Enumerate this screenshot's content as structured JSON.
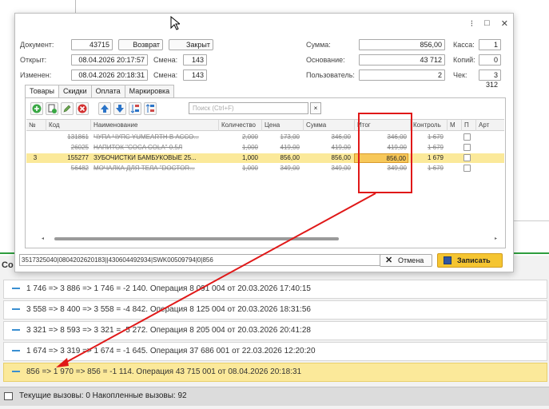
{
  "background": {
    "section_fragment": "Co"
  },
  "operations": [
    {
      "text": "1 746 => 3 886 => 1 746 = -2 140. Операция 8 091 004 от 20.03.2026 17:40:15"
    },
    {
      "text": "3 558 => 8 400 => 3 558 = -4 842. Операция 8 125 004 от 20.03.2026 18:31:56"
    },
    {
      "text": "3 321 => 8 593 => 3 321 = -5 272. Операция 8 205 004 от 20.03.2026 20:41:28"
    },
    {
      "text": "1 674 => 3 319 => 1 674 = -1 645. Операция 37 686 001 от 22.03.2026 12:20:20"
    },
    {
      "text": "856 => 1 970 => 856 = -1 114. Операция 43 715 001 от 08.04.2026 20:18:31",
      "selected": true
    }
  ],
  "status_bar": {
    "text": "Текущие вызовы: 0   Накопленные вызовы: 92"
  },
  "dialog": {
    "window_controls": [
      "⁝",
      "□",
      "✕"
    ],
    "document_label": "Документ:",
    "document_value": "43715",
    "return_button": "Возврат",
    "close_button": "Закрыт",
    "opened_label": "Открыт:",
    "opened_value": "08.04.2026 20:17:57",
    "shift_label": "Смена:",
    "shift_value": "143",
    "changed_label": "Изменен:",
    "changed_value": "08.04.2026 20:18:31",
    "shift2_label": "Смена:",
    "shift2_value": "143",
    "sum_label": "Сумма:",
    "sum_value": "856,00",
    "basis_label": "Основание:",
    "basis_value": "43 712",
    "user_label": "Пользователь:",
    "user_value": "2",
    "kassa_label": "Касса:",
    "kassa_value": "1",
    "copies_label": "Копий:",
    "copies_value": "0",
    "check_label": "Чек:",
    "check_value": "3 312",
    "tabs": [
      "Товары",
      "Скидки",
      "Оплата",
      "Маркировка"
    ],
    "search_placeholder": "Поиск (Ctrl+F)",
    "search_clear": "×",
    "columns": [
      "№",
      "Код",
      "Наименование",
      "Количество",
      "Цена",
      "Сумма",
      "Итог",
      "Контроль",
      "М",
      "П",
      "Арт"
    ],
    "rows": [
      {
        "num": "",
        "code": "131861",
        "name": "ЧУПА ЧУПС YUMEARTH В АССО...",
        "qty": "2,000",
        "price": "173,00",
        "sum": "346,00",
        "itog": "346,00",
        "control": "1 679",
        "strike": true
      },
      {
        "num": "",
        "code": "26025",
        "name": "НАПИТОК \"COCA COLA\" 0.5Л",
        "qty": "1,000",
        "price": "419,00",
        "sum": "419,00",
        "itog": "419,00",
        "control": "1 679",
        "strike": true
      },
      {
        "num": "3",
        "code": "155277",
        "name": "ЗУБОЧИСТКИ БАМБУКОВЫЕ 25...",
        "qty": "1,000",
        "price": "856,00",
        "sum": "856,00",
        "itog": "856,00",
        "control": "1 679",
        "selected": true
      },
      {
        "num": "",
        "code": "56482",
        "name": "МОЧАЛКА ДЛЯ ТЕЛА \"DOCTOR...",
        "qty": "1,000",
        "price": "349,00",
        "sum": "349,00",
        "itog": "349,00",
        "control": "1 679",
        "strike": true
      }
    ],
    "barcode_value": "3517325040|0804202620183||430604492934|SWK00509794|0|856",
    "cancel_label": "Отмена",
    "save_label": "Записать"
  },
  "colors": {
    "accent_selected": "#fbe99a",
    "annotation_red": "#e01818",
    "save_button": "#f5c531",
    "item_dash": "#3a8fd1"
  }
}
